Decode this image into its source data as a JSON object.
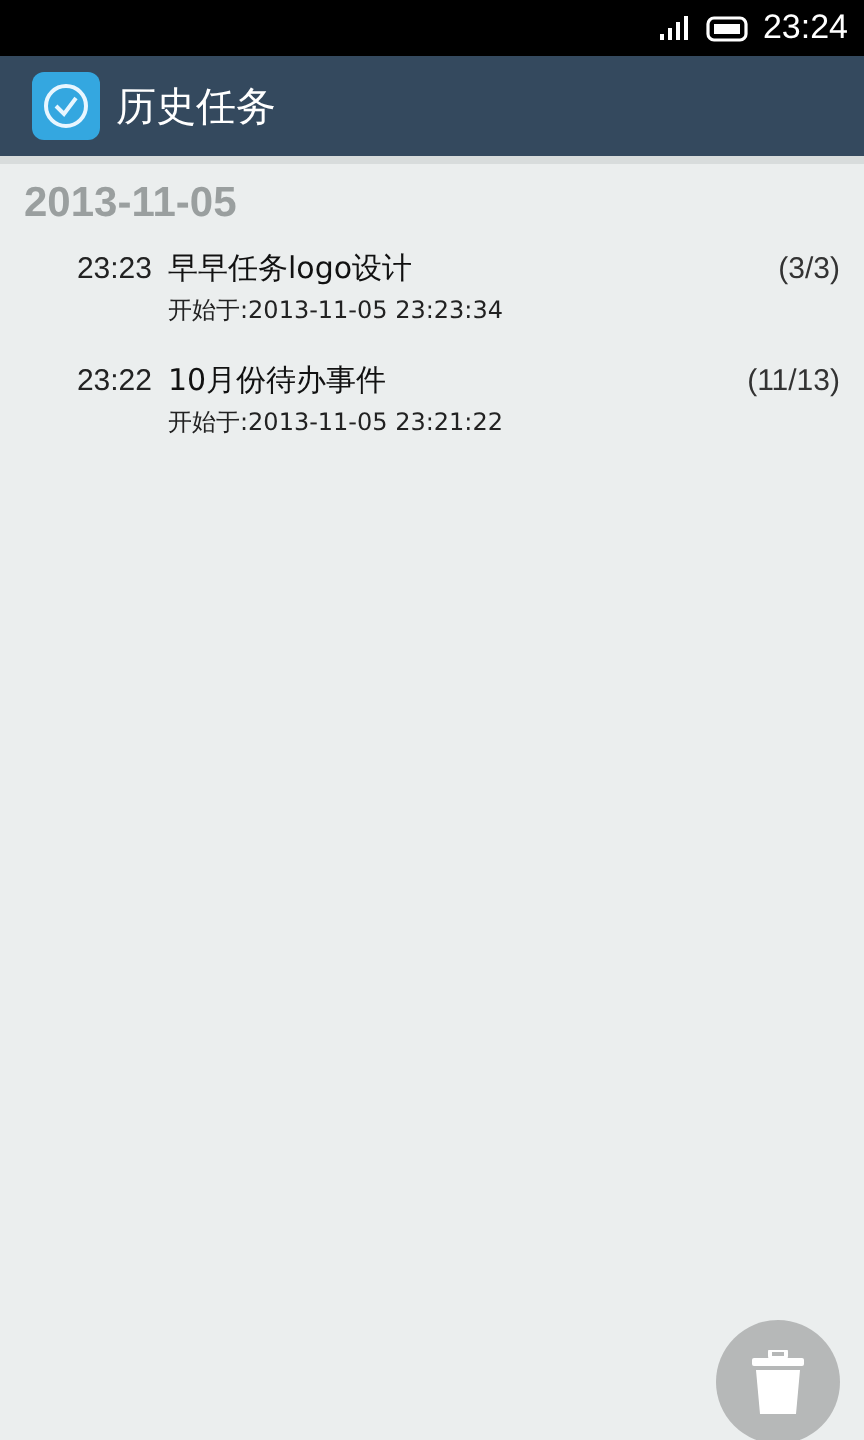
{
  "status_bar": {
    "time": "23:24"
  },
  "app_bar": {
    "title": "历史任务"
  },
  "groups": [
    {
      "date": "2013-11-05",
      "tasks": [
        {
          "time": "23:23",
          "title": "早早任务logo设计",
          "progress": "(3/3)",
          "started": "开始于:2013-11-05 23:23:34"
        },
        {
          "time": "23:22",
          "title": "10月份待办事件",
          "progress": "(11/13)",
          "started": "开始于:2013-11-05 23:21:22"
        }
      ]
    }
  ]
}
